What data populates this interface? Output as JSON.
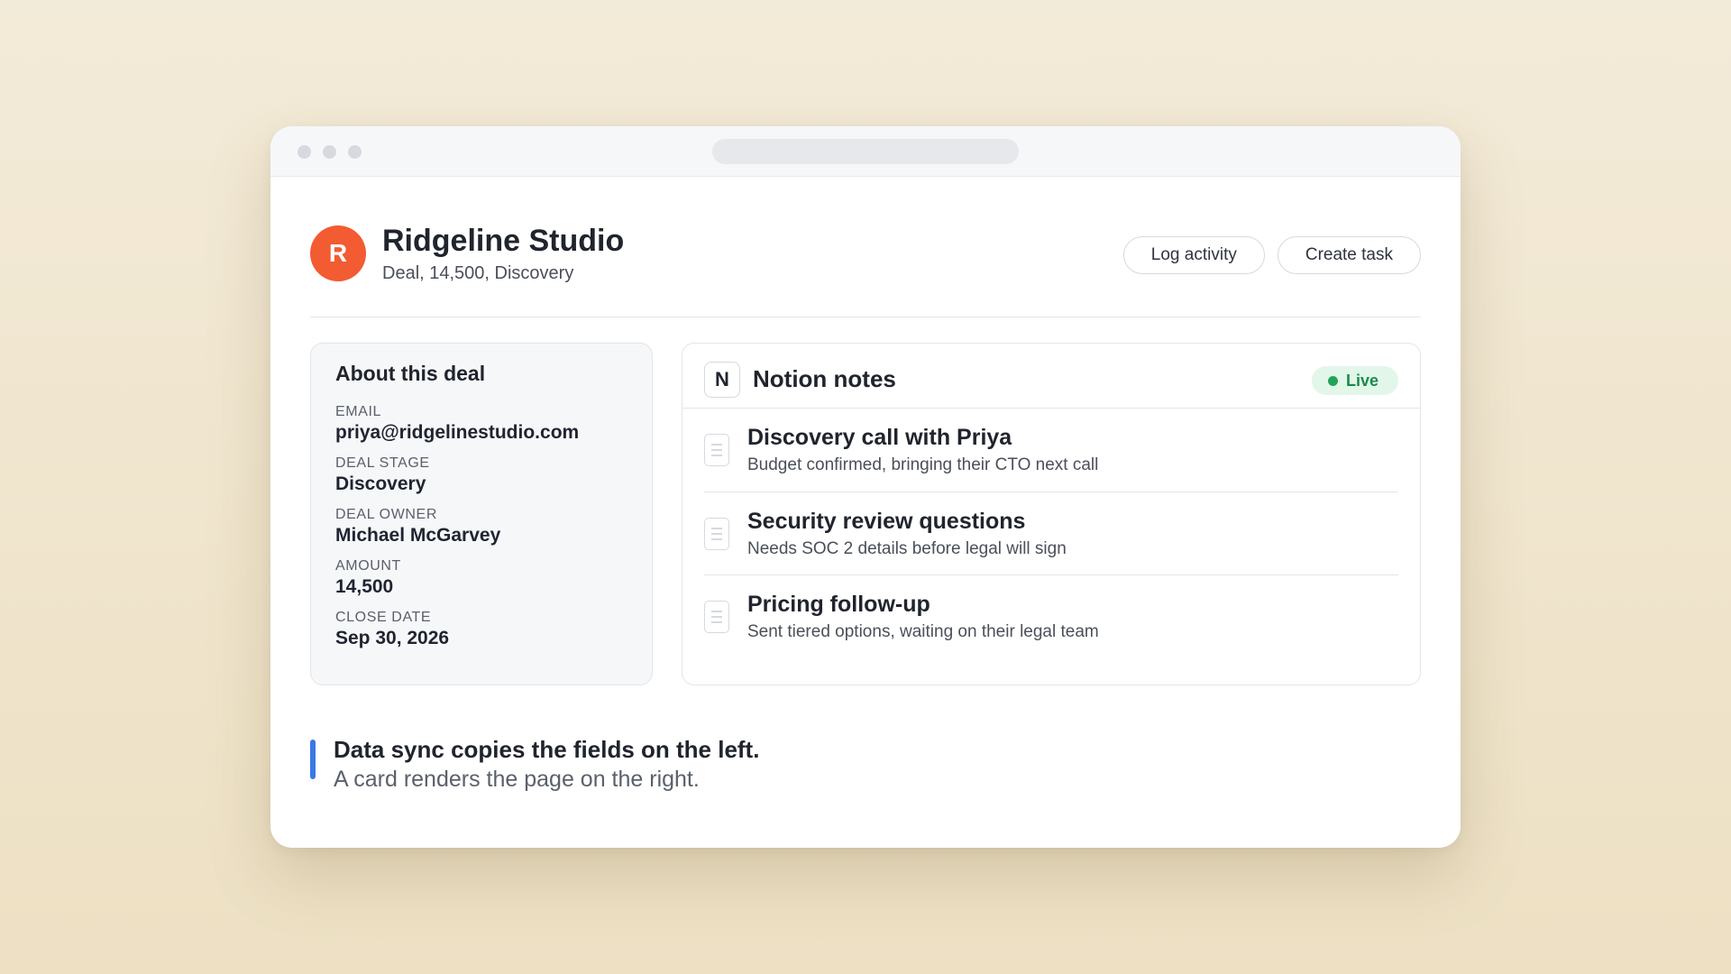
{
  "header": {
    "avatar_letter": "R",
    "avatar_color": "#f35b32",
    "title": "Ridgeline Studio",
    "subtitle": "Deal, 14,500, Discovery",
    "actions": {
      "log_activity": "Log activity",
      "create_task": "Create task"
    }
  },
  "about": {
    "title": "About this deal",
    "fields": [
      {
        "label": "EMAIL",
        "value": "priya@ridgelinestudio.com"
      },
      {
        "label": "DEAL STAGE",
        "value": "Discovery"
      },
      {
        "label": "DEAL OWNER",
        "value": "Michael McGarvey"
      },
      {
        "label": "AMOUNT",
        "value": "14,500"
      },
      {
        "label": "CLOSE DATE",
        "value": "Sep 30, 2026"
      }
    ]
  },
  "notes": {
    "logo": "N",
    "title": "Notion notes",
    "status": "Live",
    "status_color": "#1c8a4c",
    "items": [
      {
        "title": "Discovery call with Priya",
        "description": "Budget confirmed, bringing their CTO next call",
        "icon": "document-icon"
      },
      {
        "title": "Security review questions",
        "description": "Needs SOC 2 details before legal will sign",
        "icon": "document-icon"
      },
      {
        "title": "Pricing follow-up",
        "description": "Sent tiered options, waiting on their legal team",
        "icon": "document-icon"
      }
    ]
  },
  "callout": {
    "title": "Data sync copies the fields on the left.",
    "subtitle": "A card renders the page on the right.",
    "accent_color": "#3a78e6"
  }
}
